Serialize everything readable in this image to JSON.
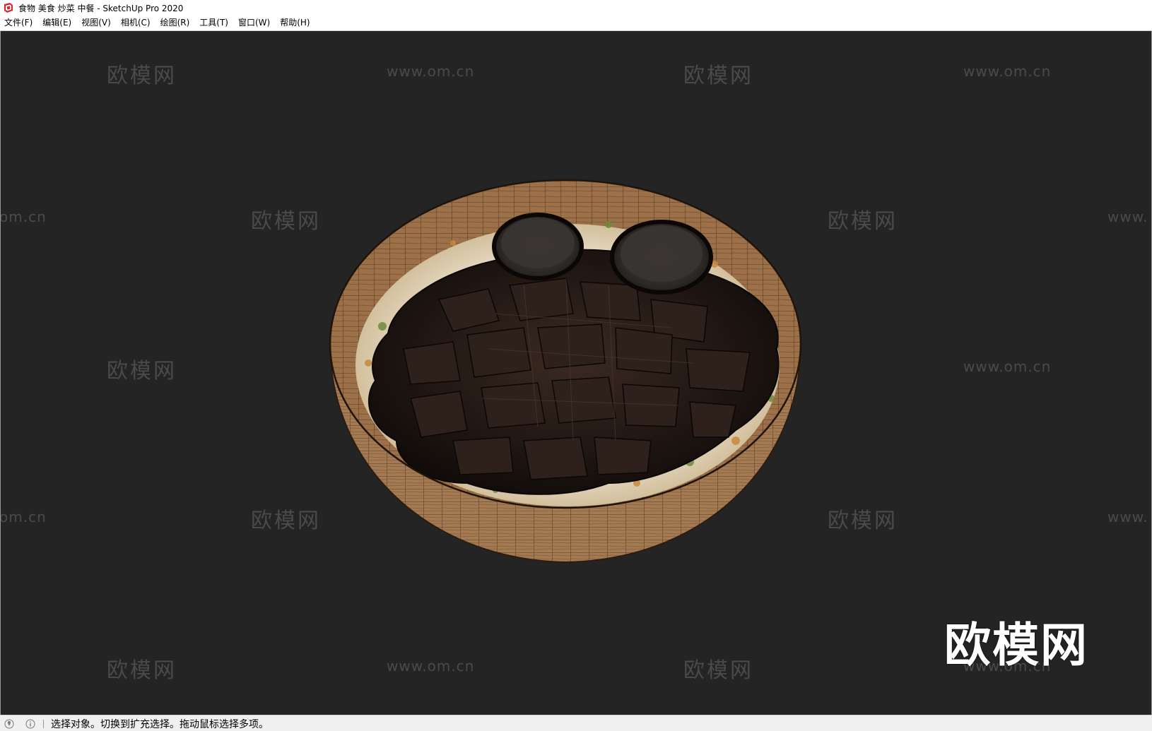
{
  "window": {
    "title": "食物 美食 炒菜 中餐 - SketchUp Pro 2020",
    "app_icon": "sketchup-logo-icon"
  },
  "menu": {
    "items": [
      {
        "label": "文件(F)"
      },
      {
        "label": "编辑(E)"
      },
      {
        "label": "视图(V)"
      },
      {
        "label": "相机(C)"
      },
      {
        "label": "绘图(R)"
      },
      {
        "label": "工具(T)"
      },
      {
        "label": "窗口(W)"
      },
      {
        "label": "帮助(H)"
      }
    ]
  },
  "viewport": {
    "background": "#242424",
    "watermark_text": "欧模网",
    "watermark_url": "www.om.cn",
    "watermark_url_partial_left": "om.cn",
    "watermark_url_partial_right": "www.",
    "logo_text": "欧模网",
    "model": "bowl-of-stir-fried-meat"
  },
  "status": {
    "geolocation_icon": "geolocation-icon",
    "info_icon": "info-icon",
    "message": "选择对象。切换到扩充选择。拖动鼠标选择多项。"
  }
}
